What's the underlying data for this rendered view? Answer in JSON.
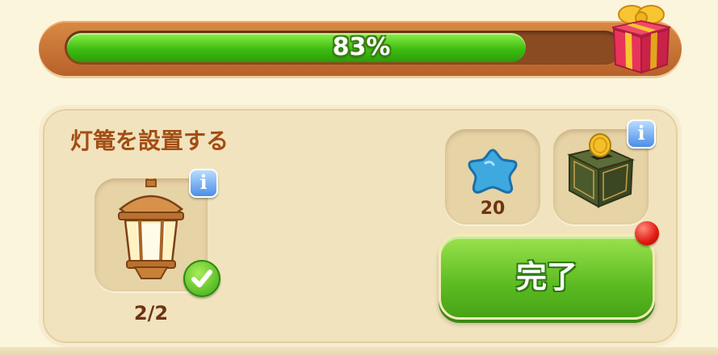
{
  "progress": {
    "percent_label": "83%",
    "fraction": 0.83
  },
  "task": {
    "title": "灯篭を設置する",
    "item": {
      "icon": "lantern-icon",
      "count": "2/2",
      "completed": true
    }
  },
  "rewards": [
    {
      "icon": "blue-star-gem-icon",
      "amount": "20"
    },
    {
      "icon": "coin-box-icon"
    }
  ],
  "info_label": "i",
  "complete_button": {
    "label": "完了"
  },
  "colors": {
    "progress_green": "#3fbd12",
    "title_brown": "#a34d15",
    "button_green": "#5cbb22",
    "notification_red": "#e01810",
    "info_blue": "#4a8ee6"
  }
}
